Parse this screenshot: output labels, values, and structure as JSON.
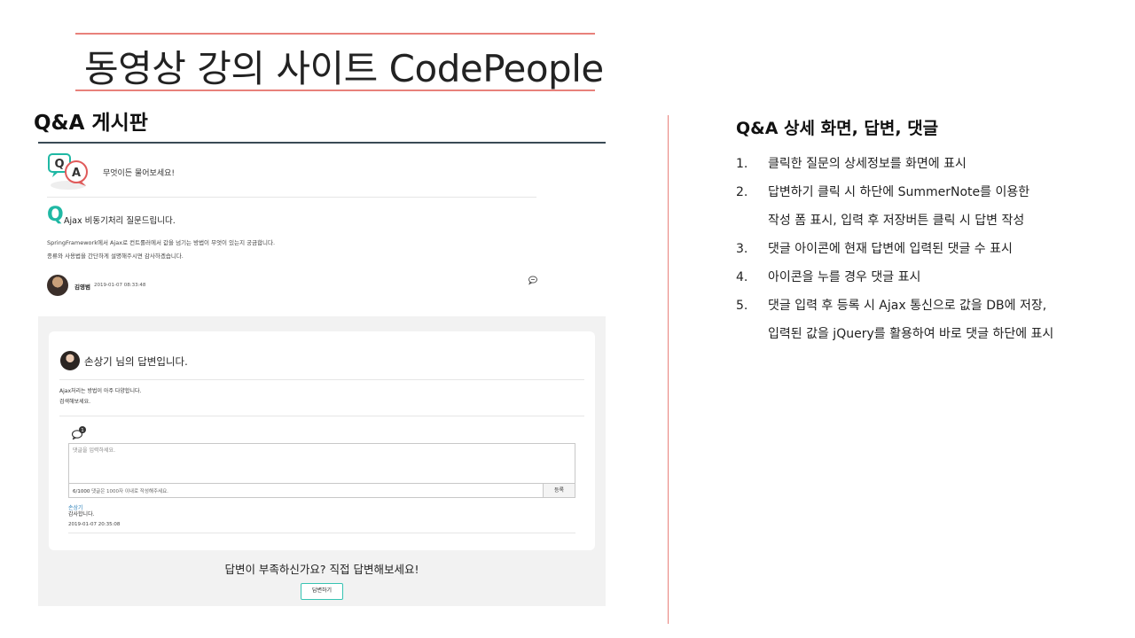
{
  "slide": {
    "title": "동영상 강의 사이트 CodePeople",
    "section_title": "Q&A 게시판",
    "accent_color": "#e8817b"
  },
  "screenshot": {
    "logo": {
      "q": "Q",
      "a": "A"
    },
    "tagline": "무엇이든 물어보세요!",
    "question": {
      "mark": "Q",
      "title": "Ajax 비동기처리 질문드립니다.",
      "body_lines": [
        "SpringFramework에서 Ajax로 컨트롤러에서 값을 넘기는 방법이 무엇이 있는지 궁금합니다.",
        "종류와 사용법을 간단하게 설명해주시면 감사하겠습니다."
      ],
      "author": "김영범",
      "date": "2019-01-07 08:33:48",
      "comment_icon": "comment-icon"
    },
    "answer": {
      "heading": "손상기 님의 답변입니다.",
      "body_lines": [
        "Ajax처리는 방법이 아주 다양합니다.",
        "검색해보세요."
      ],
      "comment_count_badge": "1",
      "comment_placeholder": "댓글을 입력하세요.",
      "char_count": "6/1000",
      "char_hint": "댓글은 1000자 이내로 작성해주세요.",
      "register_label": "등록",
      "comment": {
        "author": "손상기",
        "text": "감사합니다.",
        "date": "2019-01-07 20:35:08"
      }
    },
    "prompt": "답변이 부족하신가요? 직접 답변해보세요!",
    "answer_button_label": "답변하기",
    "teal_color": "#1fb8a4"
  },
  "right": {
    "title": "Q&A 상세 화면, 답변, 댓글",
    "items": [
      {
        "num": "1.",
        "lines": [
          "클릭한 질문의 상세정보를 화면에 표시"
        ]
      },
      {
        "num": "2.",
        "lines": [
          "답변하기 클릭 시 하단에 SummerNote를 이용한",
          "작성 폼 표시, 입력 후 저장버튼 클릭 시 답변 작성"
        ]
      },
      {
        "num": "3.",
        "lines": [
          "댓글 아이콘에 현재 답변에 입력된 댓글 수 표시"
        ]
      },
      {
        "num": "4.",
        "lines": [
          "아이콘을 누를 경우 댓글 표시"
        ]
      },
      {
        "num": "5.",
        "lines": [
          "댓글 입력 후 등록 시 Ajax 통신으로 값을 DB에 저장,",
          "입력된 값을 jQuery를 활용하여 바로 댓글 하단에 표시"
        ]
      }
    ]
  }
}
